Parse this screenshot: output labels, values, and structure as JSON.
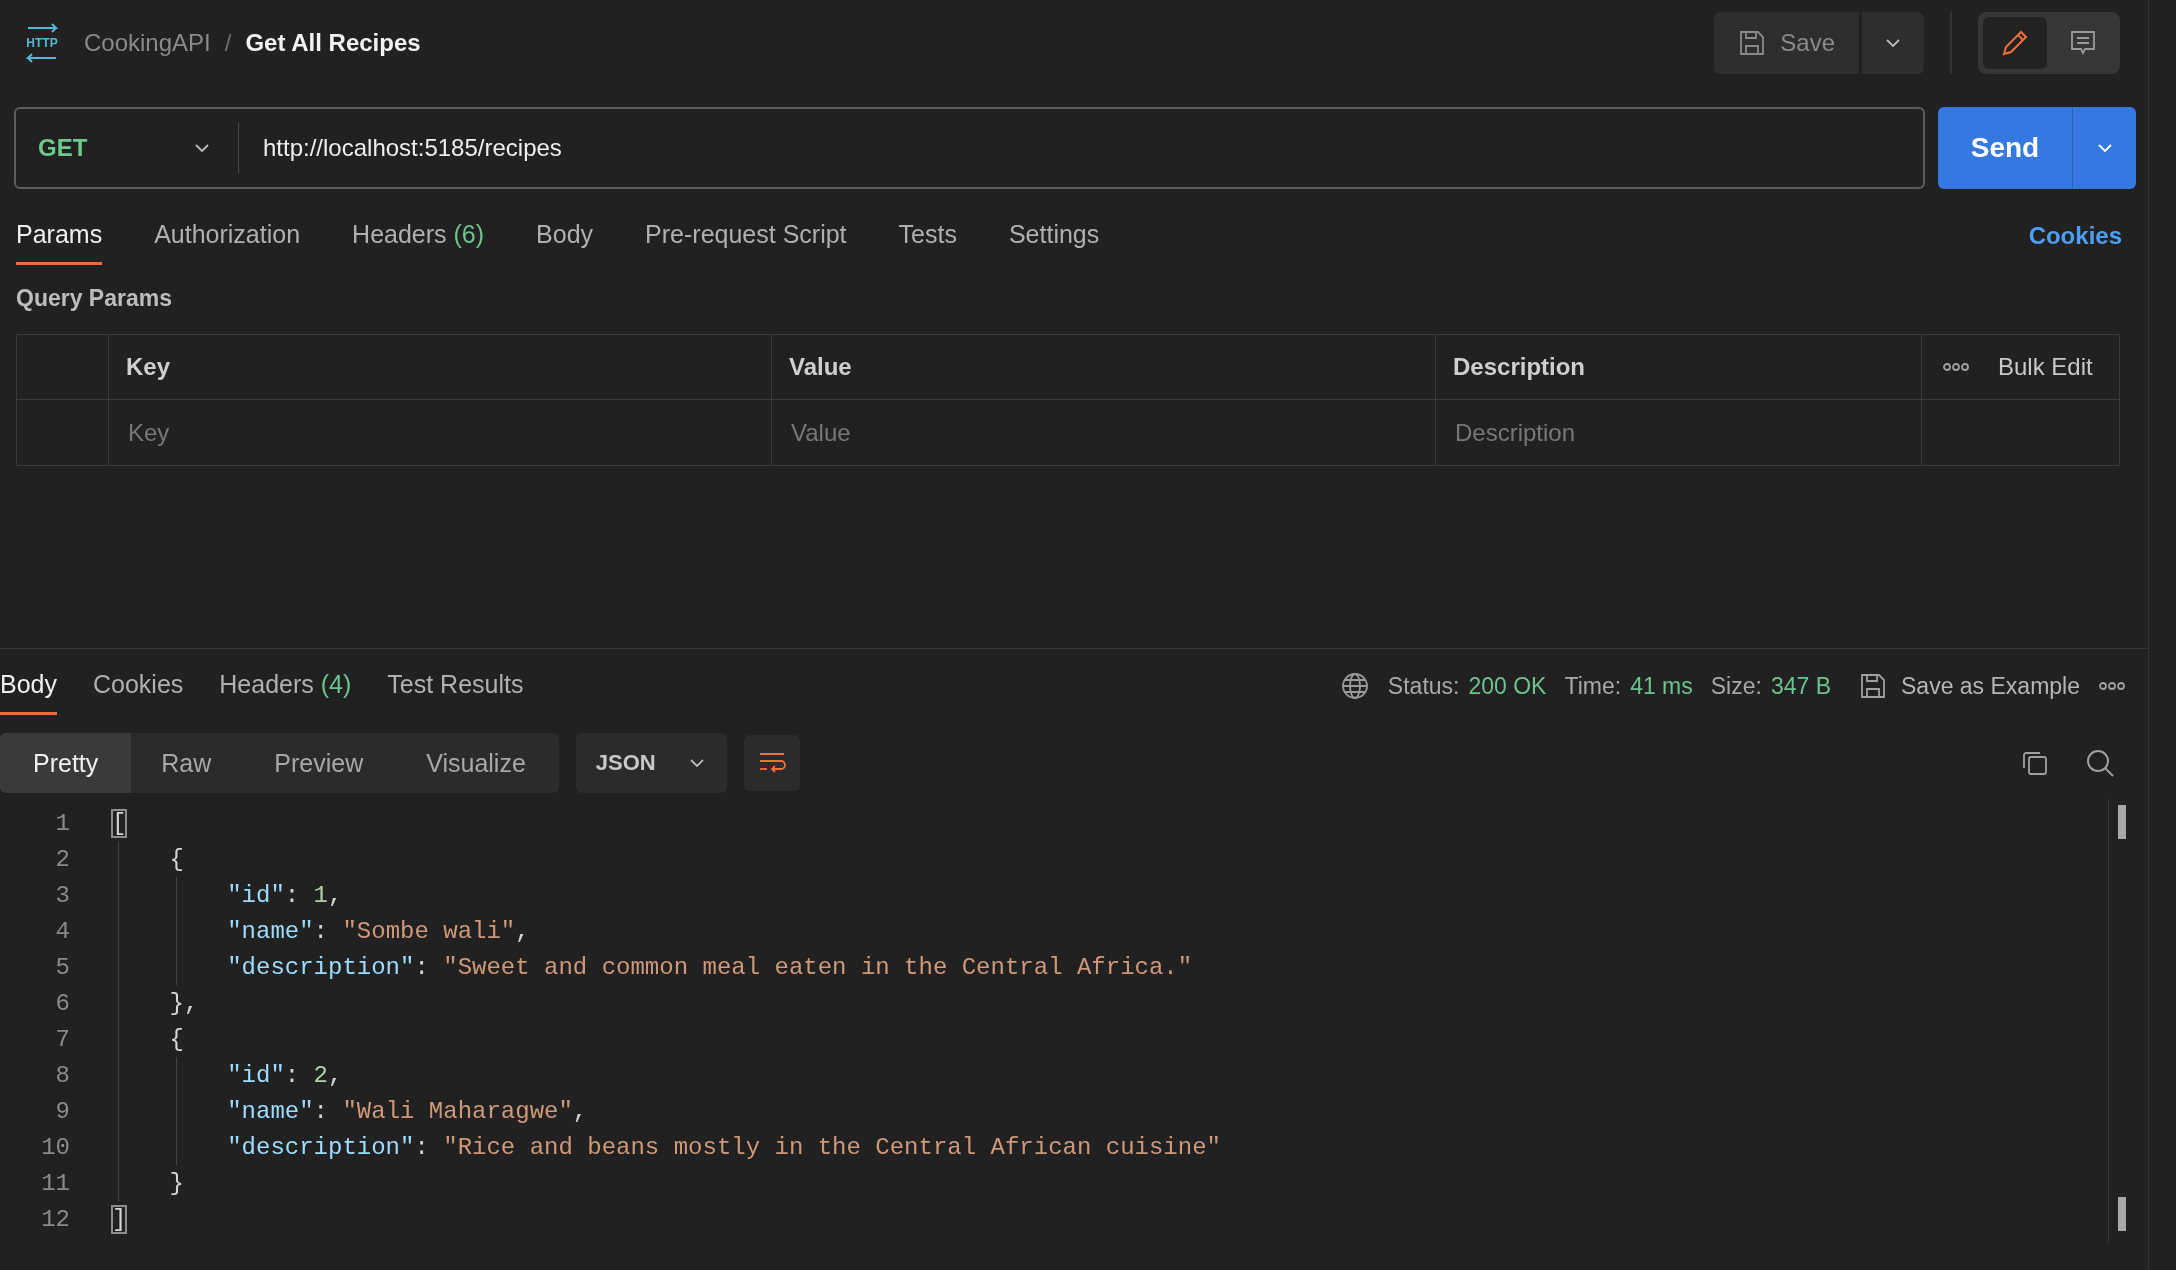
{
  "request": {
    "breadcrumb": {
      "icon_label": "HTTP",
      "collection": "CookingAPI",
      "separator": "/",
      "name": "Get All Recipes"
    },
    "save": {
      "label": "Save",
      "disabled": true
    },
    "view_modes": [
      {
        "kind": "edit",
        "selected": true
      },
      {
        "kind": "comments",
        "selected": false
      }
    ],
    "method": "GET",
    "url": "http://localhost:5185/recipes",
    "send": "Send",
    "tabs": [
      {
        "label": "Params",
        "selected": true
      },
      {
        "label": "Authorization",
        "selected": false
      },
      {
        "label": "Headers",
        "count": "(6)",
        "selected": false
      },
      {
        "label": "Body",
        "selected": false
      },
      {
        "label": "Pre-request Script",
        "selected": false
      },
      {
        "label": "Tests",
        "selected": false
      },
      {
        "label": "Settings",
        "selected": false
      }
    ],
    "cookies_link": "Cookies",
    "query_params": {
      "title": "Query Params",
      "columns": [
        "Key",
        "Value",
        "Description"
      ],
      "bulk_edit": "Bulk Edit",
      "rows": [
        {
          "key": {
            "placeholder": "Key"
          },
          "value": {
            "placeholder": "Value"
          },
          "description": {
            "placeholder": "Description"
          }
        }
      ]
    }
  },
  "response": {
    "tabs": [
      {
        "label": "Body",
        "selected": true
      },
      {
        "label": "Cookies",
        "selected": false
      },
      {
        "label": "Headers",
        "count": "(4)",
        "selected": false
      },
      {
        "label": "Test Results",
        "selected": false
      }
    ],
    "status": {
      "label": "Status:",
      "value": "200 OK"
    },
    "time": {
      "label": "Time:",
      "value": "41 ms"
    },
    "size": {
      "label": "Size:",
      "value": "347 B"
    },
    "save_example": "Save as Example",
    "view_modes": [
      {
        "label": "Pretty",
        "selected": true
      },
      {
        "label": "Raw",
        "selected": false
      },
      {
        "label": "Preview",
        "selected": false
      },
      {
        "label": "Visualize",
        "selected": false
      }
    ],
    "format": "JSON",
    "body": {
      "lines": [
        {
          "number": "1",
          "tokens": [
            {
              "kind": "matched-bracket",
              "text": "["
            }
          ],
          "children": [
            {
              "number": "2",
              "tokens": [
                {
                  "kind": "punct",
                  "text": "{"
                }
              ],
              "children": [
                {
                  "number": "3",
                  "tokens": [
                    {
                      "kind": "key",
                      "text": "\"id\""
                    },
                    {
                      "kind": "punct",
                      "text": ": "
                    },
                    {
                      "kind": "number",
                      "text": "1"
                    },
                    {
                      "kind": "punct",
                      "text": ","
                    }
                  ]
                },
                {
                  "number": "4",
                  "tokens": [
                    {
                      "kind": "key",
                      "text": "\"name\""
                    },
                    {
                      "kind": "punct",
                      "text": ": "
                    },
                    {
                      "kind": "string",
                      "text": "\"Sombe wali\""
                    },
                    {
                      "kind": "punct",
                      "text": ","
                    }
                  ]
                },
                {
                  "number": "5",
                  "tokens": [
                    {
                      "kind": "key",
                      "text": "\"description\""
                    },
                    {
                      "kind": "punct",
                      "text": ": "
                    },
                    {
                      "kind": "string",
                      "text": "\"Sweet and common meal eaten in the Central Africa.\""
                    }
                  ]
                }
              ]
            },
            {
              "number": "6",
              "tokens": [
                {
                  "kind": "punct",
                  "text": "},"
                }
              ]
            },
            {
              "number": "7",
              "tokens": [
                {
                  "kind": "punct",
                  "text": "{"
                }
              ],
              "children": [
                {
                  "number": "8",
                  "tokens": [
                    {
                      "kind": "key",
                      "text": "\"id\""
                    },
                    {
                      "kind": "punct",
                      "text": ": "
                    },
                    {
                      "kind": "number",
                      "text": "2"
                    },
                    {
                      "kind": "punct",
                      "text": ","
                    }
                  ]
                },
                {
                  "number": "9",
                  "tokens": [
                    {
                      "kind": "key",
                      "text": "\"name\""
                    },
                    {
                      "kind": "punct",
                      "text": ": "
                    },
                    {
                      "kind": "string",
                      "text": "\"Wali Maharagwe\""
                    },
                    {
                      "kind": "punct",
                      "text": ","
                    }
                  ]
                },
                {
                  "number": "10",
                  "tokens": [
                    {
                      "kind": "key",
                      "text": "\"description\""
                    },
                    {
                      "kind": "punct",
                      "text": ": "
                    },
                    {
                      "kind": "string",
                      "text": "\"Rice and beans mostly in the Central African cuisine\""
                    }
                  ]
                }
              ]
            },
            {
              "number": "11",
              "tokens": [
                {
                  "kind": "punct",
                  "text": "}"
                }
              ]
            }
          ]
        },
        {
          "number": "12",
          "tokens": [
            {
              "kind": "matched-bracket",
              "text": "]"
            }
          ]
        }
      ]
    }
  }
}
